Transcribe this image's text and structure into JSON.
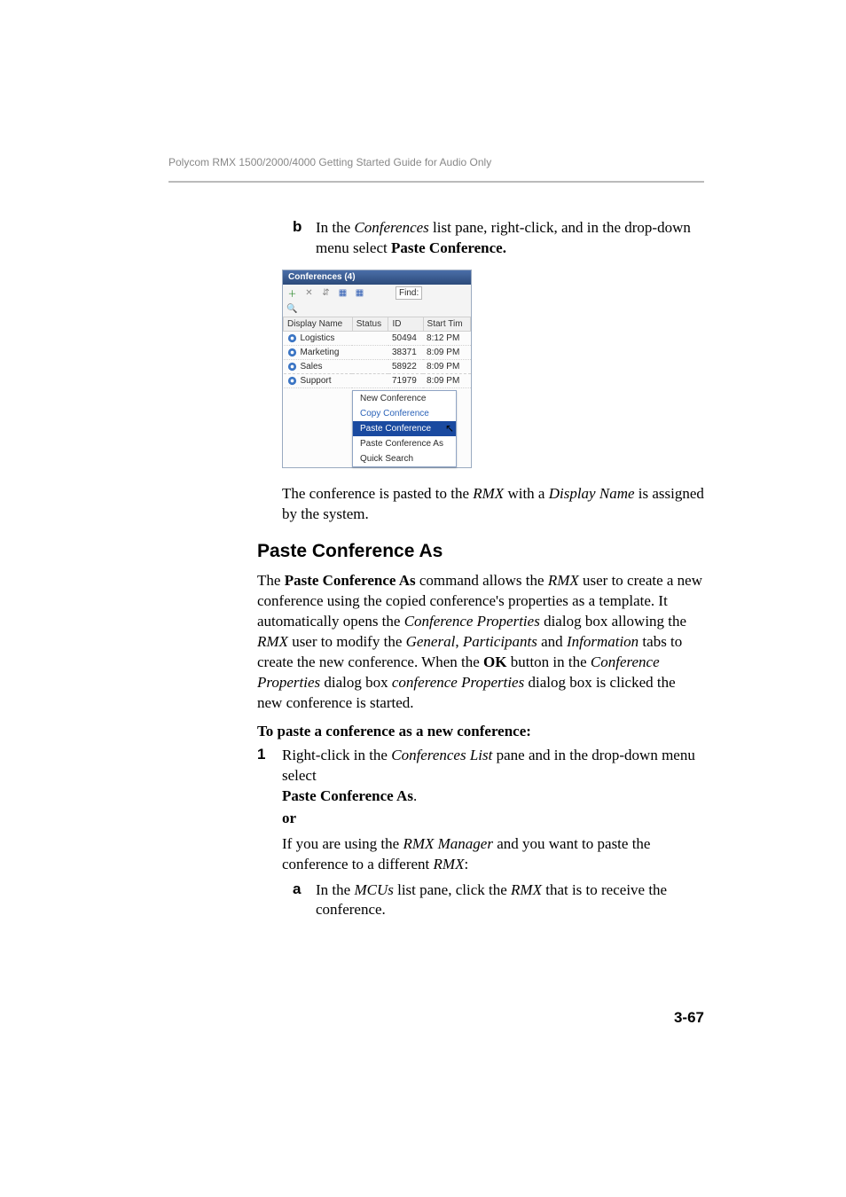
{
  "header": {
    "running": "Polycom RMX 1500/2000/4000 Getting Started Guide for Audio Only"
  },
  "step_b": {
    "marker": "b",
    "pre": "In the ",
    "it1": "Conferences",
    "mid": " list pane, right-click, and in the drop-down menu select ",
    "bold": "Paste Conference."
  },
  "app": {
    "title": "Conferences (4)",
    "toolbar": {
      "add_icon": "＋",
      "delete_icon": "✕",
      "hier_icon": "⇵",
      "grid1_icon": "▦",
      "grid2_icon": "▦",
      "search_icon": "🔍",
      "find_label": "Find:"
    },
    "columns": [
      "Display Name",
      "Status",
      "ID",
      "Start Tim"
    ],
    "rows": [
      {
        "name": "Logistics",
        "status": "",
        "id": "50494",
        "start": "8:12 PM"
      },
      {
        "name": "Marketing",
        "status": "",
        "id": "38371",
        "start": "8:09 PM"
      },
      {
        "name": "Sales",
        "status": "",
        "id": "58922",
        "start": "8:09 PM"
      },
      {
        "name": "Support",
        "status": "",
        "id": "71979",
        "start": "8:09 PM"
      }
    ],
    "menu": {
      "new": "New Conference",
      "copy": "Copy Conference",
      "paste": "Paste Conference",
      "paste_as": "Paste Conference As",
      "quick": "Quick Search"
    }
  },
  "after_para": {
    "pre": "The conference is pasted to the ",
    "it1": "RMX",
    "mid": " with a ",
    "it2": "Display Name",
    "post": " is assigned by the system."
  },
  "section_heading": "Paste Conference As",
  "body_para": {
    "p1": "The ",
    "b1": "Paste Conference As",
    "p2": " command allows the ",
    "i1": "RMX",
    "p3": " user to create a new conference using the copied conference's properties as a template. It automatically opens the ",
    "i2": "Conference Properties",
    "p4": " dialog box allowing the ",
    "i3": "RMX",
    "p5": " user to modify the ",
    "i4": "General",
    "p6": ", ",
    "i5": "Participants",
    "p7": " and ",
    "i6": "Information",
    "p8": " tabs to create the new conference. When the ",
    "b2": "OK",
    "p9": " button in the ",
    "i7": "Conference Properties",
    "p10": " dialog box ",
    "i8": "conference Properties",
    "p11": " dialog box is clicked the new conference is started."
  },
  "proc_head": "To paste a conference as a new conference:",
  "step1": {
    "marker": "1",
    "pre": "Right-click in the ",
    "it1": "Conferences List",
    "mid": " pane and in the drop-down menu select",
    "bold_line": "Paste Conference As",
    "period": "."
  },
  "or_text": "or",
  "if_line": {
    "pre": "If you are using the ",
    "it1": "RMX Manager",
    "mid": " and you want to paste the conference to a different ",
    "it2": "RMX",
    "post": ":"
  },
  "step_a_inner": {
    "marker": "a",
    "pre": "In the ",
    "it1": "MCUs",
    "mid": " list pane, click the ",
    "it2": "RMX",
    "post": " that is to receive the conference."
  },
  "page_number": "3-67"
}
